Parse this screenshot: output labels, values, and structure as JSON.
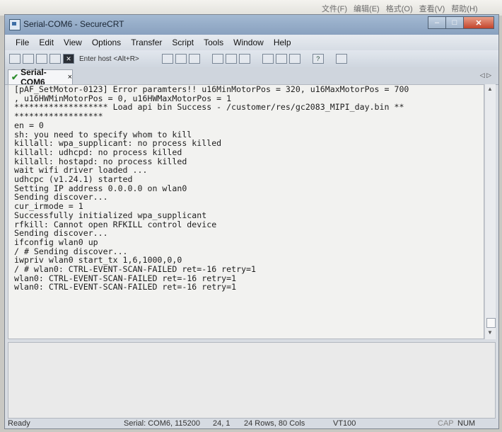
{
  "background_menu": [
    "文件(F)",
    "编辑(E)",
    "格式(O)",
    "查看(V)",
    "帮助(H)"
  ],
  "window": {
    "title": "Serial-COM6 - SecureCRT"
  },
  "menu": [
    "File",
    "Edit",
    "View",
    "Options",
    "Transfer",
    "Script",
    "Tools",
    "Window",
    "Help"
  ],
  "toolbar": {
    "host_placeholder": "Enter host <Alt+R>"
  },
  "tab": {
    "label": "Serial-COM6",
    "close": "×"
  },
  "terminal_lines": [
    "[pAF_SetMotor-0123] Error paramters!! u16MinMotorPos = 320, u16MaxMotorPos = 700",
    ", u16HWMinMotorPos = 0, u16HWMaxMotorPos = 1",
    "******************* Load api bin Success - /customer/res/gc2083_MIPI_day.bin **",
    "******************",
    "en = 0",
    "sh: you need to specify whom to kill",
    "killall: wpa_supplicant: no process killed",
    "killall: udhcpd: no process killed",
    "killall: hostapd: no process killed",
    "wait wifi driver loaded ...",
    "udhcpc (v1.24.1) started",
    "Setting IP address 0.0.0.0 on wlan0",
    "Sending discover...",
    "cur_irmode = 1",
    "Successfully initialized wpa_supplicant",
    "rfkill: Cannot open RFKILL control device",
    "Sending discover...",
    "ifconfig wlan0 up",
    "/ # Sending discover...",
    "iwpriv wlan0 start_tx 1,6,1000,0,0",
    "/ # wlan0: CTRL-EVENT-SCAN-FAILED ret=-16 retry=1",
    "wlan0: CTRL-EVENT-SCAN-FAILED ret=-16 retry=1",
    "wlan0: CTRL-EVENT-SCAN-FAILED ret=-16 retry=1"
  ],
  "status": {
    "state": "Ready",
    "serial": "Serial: COM6, 115200",
    "cursor": "24,  1",
    "size": "24 Rows, 80 Cols",
    "emulation": "VT100",
    "cap": "CAP",
    "num": "NUM"
  }
}
